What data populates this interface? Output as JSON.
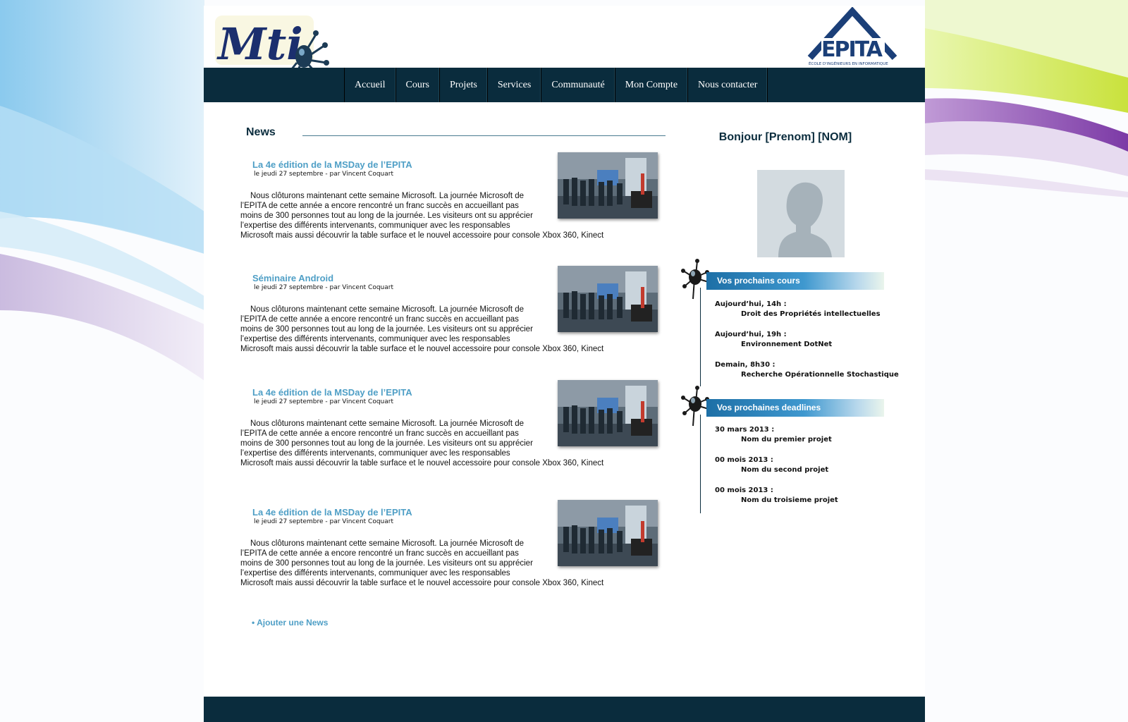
{
  "header": {
    "logo_text": "Mti",
    "school_logo": {
      "name": "EPITA",
      "tagline": "ÉCOLE D'INGÉNIEURS EN INFORMATIQUE"
    }
  },
  "nav": {
    "items": [
      {
        "label": "Accueil"
      },
      {
        "label": "Cours"
      },
      {
        "label": "Projets"
      },
      {
        "label": "Services"
      },
      {
        "label": "Communauté"
      },
      {
        "label": "Mon Compte"
      },
      {
        "label": "Nous contacter"
      }
    ]
  },
  "news": {
    "title": "News",
    "articles": [
      {
        "title": "La 4e édition de la MSDay de l’EPITA",
        "meta": "le jeudi 27 septembre - par Vincent Coquart",
        "body": [
          "Nous clôturons maintenant cette semaine Microsoft. La journée Microsoft de",
          "l’EPITA de cette année a encore rencontré un franc succès en accueillant pas",
          "moins de 300 personnes tout au long de la journée. Les visiteurs ont su apprécier",
          "l’expertise des différents intervenants, communiquer avec les responsables",
          "Microsoft mais aussi découvrir la table surface et le nouvel accessoire pour console Xbox 360, Kinect"
        ]
      },
      {
        "title": "Séminaire Android",
        "meta": "le jeudi 27 septembre - par Vincent Coquart",
        "body": [
          "Nous clôturons maintenant cette semaine Microsoft. La journée Microsoft de",
          "l’EPITA de cette année a encore rencontré un franc succès en accueillant pas",
          "moins de 300 personnes tout au long de la journée. Les visiteurs ont su apprécier",
          "l’expertise des différents intervenants, communiquer avec les responsables",
          "Microsoft mais aussi découvrir la table surface et le nouvel accessoire pour console Xbox 360, Kinect"
        ]
      },
      {
        "title": "La 4e édition de la MSDay de l’EPITA",
        "meta": "le jeudi 27 septembre - par Vincent Coquart",
        "body": [
          "Nous clôturons maintenant cette semaine Microsoft. La journée Microsoft de",
          "l’EPITA de cette année a encore rencontré un franc succès en accueillant pas",
          "moins de 300 personnes tout au long de la journée. Les visiteurs ont su apprécier",
          "l’expertise des différents intervenants, communiquer avec les responsables",
          "Microsoft mais aussi découvrir la table surface et le nouvel accessoire pour console Xbox 360, Kinect"
        ]
      },
      {
        "title": "La 4e édition de la MSDay de l’EPITA",
        "meta": "le jeudi 27 septembre - par Vincent Coquart",
        "body": [
          "Nous clôturons maintenant cette semaine Microsoft. La journée Microsoft de",
          "l’EPITA de cette année a encore rencontré un franc succès en accueillant pas",
          "moins de 300 personnes tout au long de la journée. Les visiteurs ont su apprécier",
          "l’expertise des différents intervenants, communiquer avec les responsables",
          "Microsoft mais aussi découvrir la table surface et le nouvel accessoire pour console Xbox 360, Kinect"
        ]
      }
    ],
    "add_label": "• Ajouter une News"
  },
  "sidebar": {
    "greeting": "Bonjour [Prenom] [NOM]",
    "courses": {
      "title": "Vos prochains cours",
      "items": [
        {
          "when": "Aujourd’hui, 14h :",
          "what": "Droit des Propriétés intellectuelles"
        },
        {
          "when": "Aujourd’hui, 19h :",
          "what": "Environnement DotNet"
        },
        {
          "when": "Demain, 8h30 :",
          "what": "Recherche Opérationnelle Stochastique"
        }
      ]
    },
    "deadlines": {
      "title": "Vos prochaines deadlines",
      "items": [
        {
          "when": "30 mars 2013 :",
          "what": "Nom du premier projet"
        },
        {
          "when": "00 mois 2013 :",
          "what": "Nom du second projet"
        },
        {
          "when": "00 mois 2013 :",
          "what": "Nom du troisieme projet"
        }
      ]
    }
  },
  "colors": {
    "navy": "#0a2c3d",
    "accent_blue": "#4f9fc6",
    "gradient_blue": "#3f98cf"
  }
}
